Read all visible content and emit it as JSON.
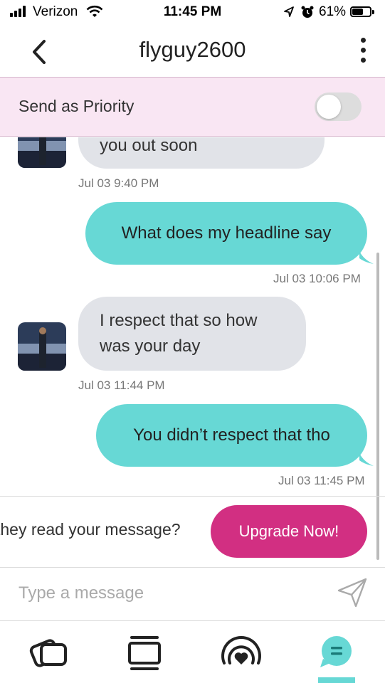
{
  "status_bar": {
    "carrier": "Verizon",
    "time": "11:45 PM",
    "battery_percent": "61%",
    "battery_level": 0.61,
    "icons": [
      "signal-icon",
      "wifi-icon",
      "location-icon",
      "alarm-icon",
      "battery-icon"
    ]
  },
  "header": {
    "title": "flyguy2600",
    "back_icon": "chevron-left-icon",
    "menu_icon": "kebab-menu-icon"
  },
  "priority": {
    "label": "Send as Priority",
    "enabled": false
  },
  "messages": [
    {
      "direction": "incoming",
      "text_lines": [
        "you out soon"
      ],
      "timestamp": "Jul 03 9:40 PM"
    },
    {
      "direction": "outgoing",
      "text_lines": [
        "What does my headline say"
      ],
      "timestamp": "Jul 03 10:06 PM"
    },
    {
      "direction": "incoming",
      "text_lines": [
        "I respect that so how",
        "was your day"
      ],
      "timestamp": "Jul 03 11:44 PM"
    },
    {
      "direction": "outgoing",
      "text_lines": [
        "You didn’t respect that tho"
      ],
      "timestamp": "Jul 03 11:45 PM"
    }
  ],
  "upsell": {
    "text": "they read your message?",
    "button_label": "Upgrade Now!"
  },
  "composer": {
    "placeholder": "Type a message",
    "send_icon": "send-icon"
  },
  "bottom_nav": {
    "items": [
      "cards-icon",
      "browse-icon",
      "live-icon",
      "chat-icon"
    ],
    "active": "chat-icon"
  },
  "colors": {
    "accent_teal": "#67d8d5",
    "upgrade_pink": "#d22f82",
    "priority_bg": "#f9e6f3",
    "incoming_bubble": "#e1e3e8"
  }
}
